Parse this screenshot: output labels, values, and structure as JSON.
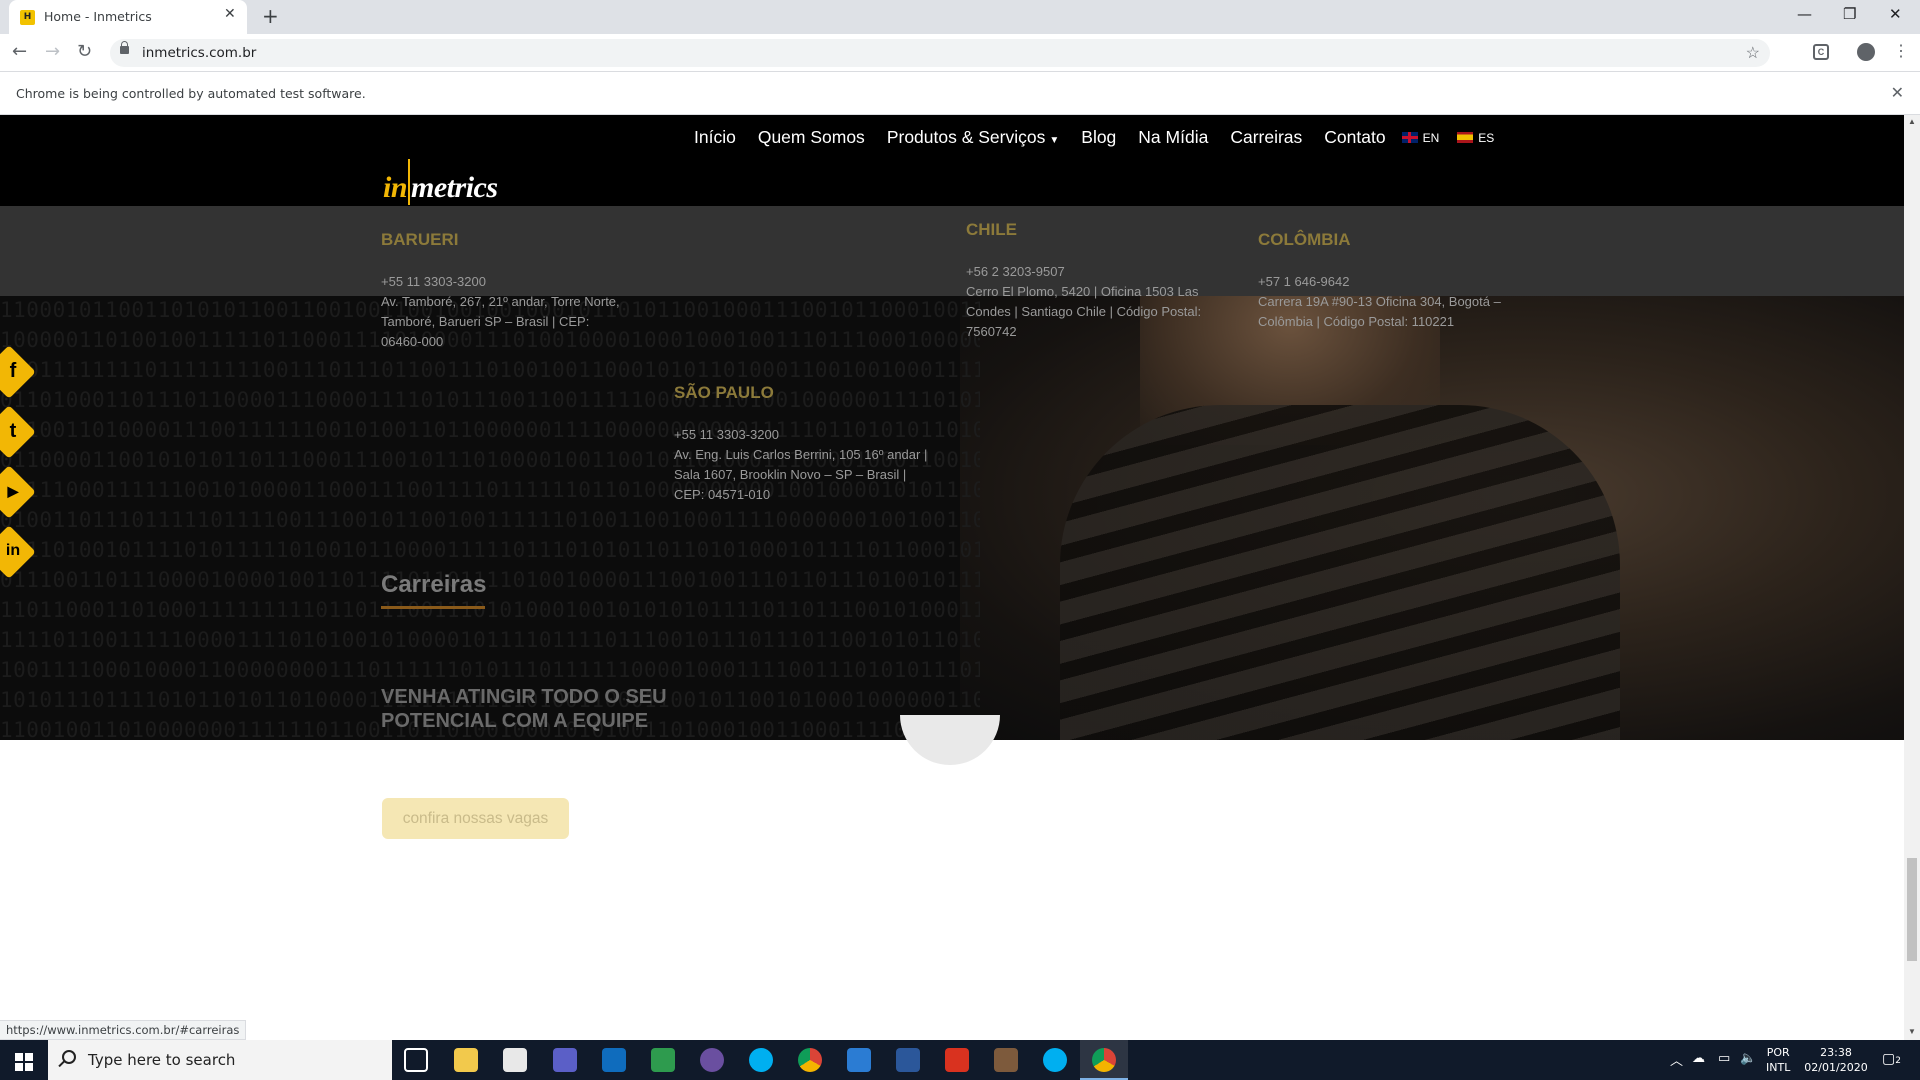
{
  "browser": {
    "tab_title": "Home - Inmetrics",
    "tab_favicon_letter": "H",
    "url": "inmetrics.com.br",
    "infobar_text": "Chrome is being controlled by automated test software.",
    "status_url": "https://www.inmetrics.com.br/#carreiras"
  },
  "nav": {
    "items": [
      "Início",
      "Quem Somos",
      "Produtos & Serviços",
      "Blog",
      "Na Mídia",
      "Carreiras",
      "Contato"
    ],
    "lang_en": "EN",
    "lang_es": "ES"
  },
  "logo": {
    "part1": "in",
    "part2": "metrics"
  },
  "offices": {
    "barueri": {
      "title": "BARUERI",
      "phone": "+55 11 3303-3200",
      "address": "Av. Tamboré, 267, 21º andar, Torre Norte, Tamboré, Barueri SP – Brasil | CEP: 06460-000"
    },
    "chile": {
      "title": "CHILE",
      "phone": "+56 2 3203-9507",
      "address": "Cerro El Plomo, 5420 | Oficina 1503 Las Condes | Santiago Chile | Código Postal: 7560742"
    },
    "colombia": {
      "title": "COLÔMBIA",
      "phone": "+57 1 646-9642",
      "address": "Carrera 19A #90-13 Oficina 304, Bogotá – Colômbia | Código Postal: 110221"
    },
    "saopaulo": {
      "title": "SÃO PAULO",
      "phone": "+55 11 3303-3200",
      "address": "Av. Eng. Luis Carlos Berrini, 105 16º andar | Sala 1607, Brooklin Novo – SP – Brasil | CEP: 04571-010"
    }
  },
  "careers": {
    "title": "Carreiras",
    "subtitle": "VENHA ATINGIR TODO O SEU POTENCIAL COM A EQUIPE",
    "cta": "confira nossas vagas"
  },
  "social": [
    {
      "name": "facebook",
      "glyph": "f"
    },
    {
      "name": "twitter",
      "glyph": "t"
    },
    {
      "name": "youtube",
      "glyph": "▶"
    },
    {
      "name": "linkedin",
      "glyph": "in"
    }
  ],
  "taskbar": {
    "search_placeholder": "Type here to search",
    "lang_line1": "POR",
    "lang_line2": "INTL",
    "time": "23:38",
    "date": "02/01/2020",
    "notifications": "2"
  }
}
